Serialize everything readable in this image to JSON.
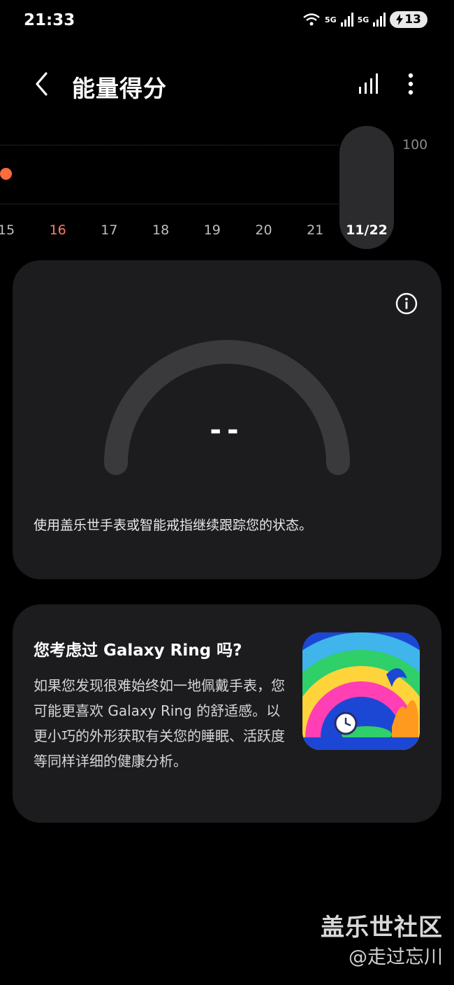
{
  "status_bar": {
    "time": "21:33",
    "signal1": "5G",
    "signal2": "5G",
    "battery": "13"
  },
  "header": {
    "title": "能量得分"
  },
  "trend": {
    "y_max_label": "100",
    "days": [
      "15",
      "16",
      "17",
      "18",
      "19",
      "20",
      "21",
      "11/22"
    ],
    "weekend_day": "16",
    "selected_day": "11/22",
    "dot_color": "#ff6b3d"
  },
  "score_card": {
    "value": "--",
    "note": "使用盖乐世手表或智能戒指继续跟踪您的状态。"
  },
  "ring_card": {
    "title": "您考虑过 Galaxy Ring 吗?",
    "body": "如果您发现很难始终如一地佩戴手表，您可能更喜欢 Galaxy Ring 的舒适感。以更小巧的外形获取有关您的睡眠、活跃度等同样详细的健康分析。"
  },
  "watermark": {
    "title": "盖乐世社区",
    "author": "@走过忘川"
  },
  "icons": {
    "back": "chevron-left-icon",
    "chart": "bar-chart-icon",
    "more": "more-vertical-icon",
    "info": "info-icon"
  }
}
